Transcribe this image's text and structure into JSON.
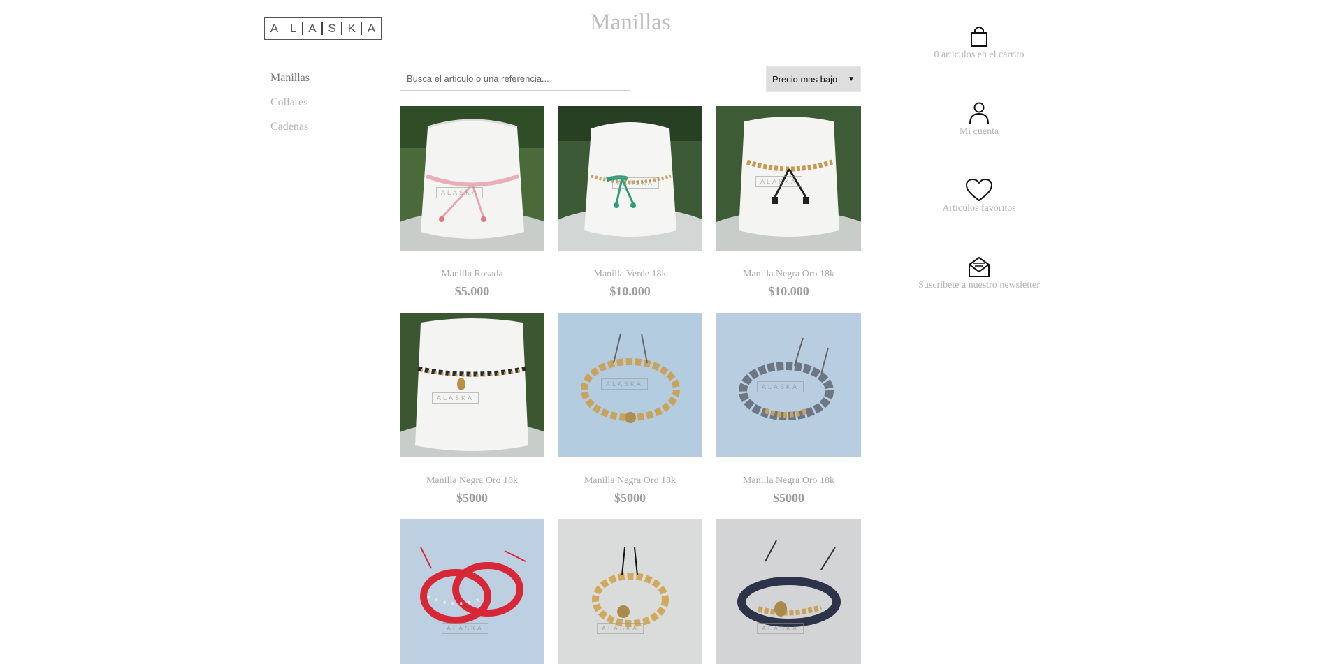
{
  "brand": {
    "logo_letters": [
      "A",
      "L",
      "A",
      "S",
      "K",
      "A"
    ]
  },
  "page": {
    "title": "Manillas"
  },
  "sidebar": {
    "items": [
      {
        "label": "Manillas",
        "active": true
      },
      {
        "label": "Collares",
        "active": false
      },
      {
        "label": "Cadenas",
        "active": false
      }
    ]
  },
  "search": {
    "placeholder": "Busca el articulo o una referencia...",
    "value": ""
  },
  "sort": {
    "selected": "Precio mas bajo"
  },
  "products": [
    {
      "name": "Manilla Rosada",
      "price": "$5.000"
    },
    {
      "name": "Manilla Verde 18k",
      "price": "$10.000"
    },
    {
      "name": "Manilla Negra Oro 18k",
      "price": "$10.000"
    },
    {
      "name": "Manilla Negra Oro 18k",
      "price": "$5000"
    },
    {
      "name": "Manilla Negra Oro 18k",
      "price": "$5000"
    },
    {
      "name": "Manilla Negra Oro 18k",
      "price": "$5000"
    },
    {
      "name": "",
      "price": ""
    },
    {
      "name": "",
      "price": ""
    },
    {
      "name": "",
      "price": ""
    }
  ],
  "right_panel": {
    "cart": {
      "label": "0 articulos en el carrito",
      "icon": "shopping-bag-icon"
    },
    "account": {
      "label": "Mi cuenta",
      "icon": "user-icon"
    },
    "favorites": {
      "label": "Articulos favoritos",
      "icon": "heart-icon"
    },
    "newsletter": {
      "label": "Suscribete a nuestro newsletter",
      "icon": "envelope-icon"
    }
  },
  "colors": {
    "title": "#bdbdbd",
    "muted_text": "#b3b3b3",
    "price": "#9d9d9d",
    "sort_bg": "#dedede"
  }
}
